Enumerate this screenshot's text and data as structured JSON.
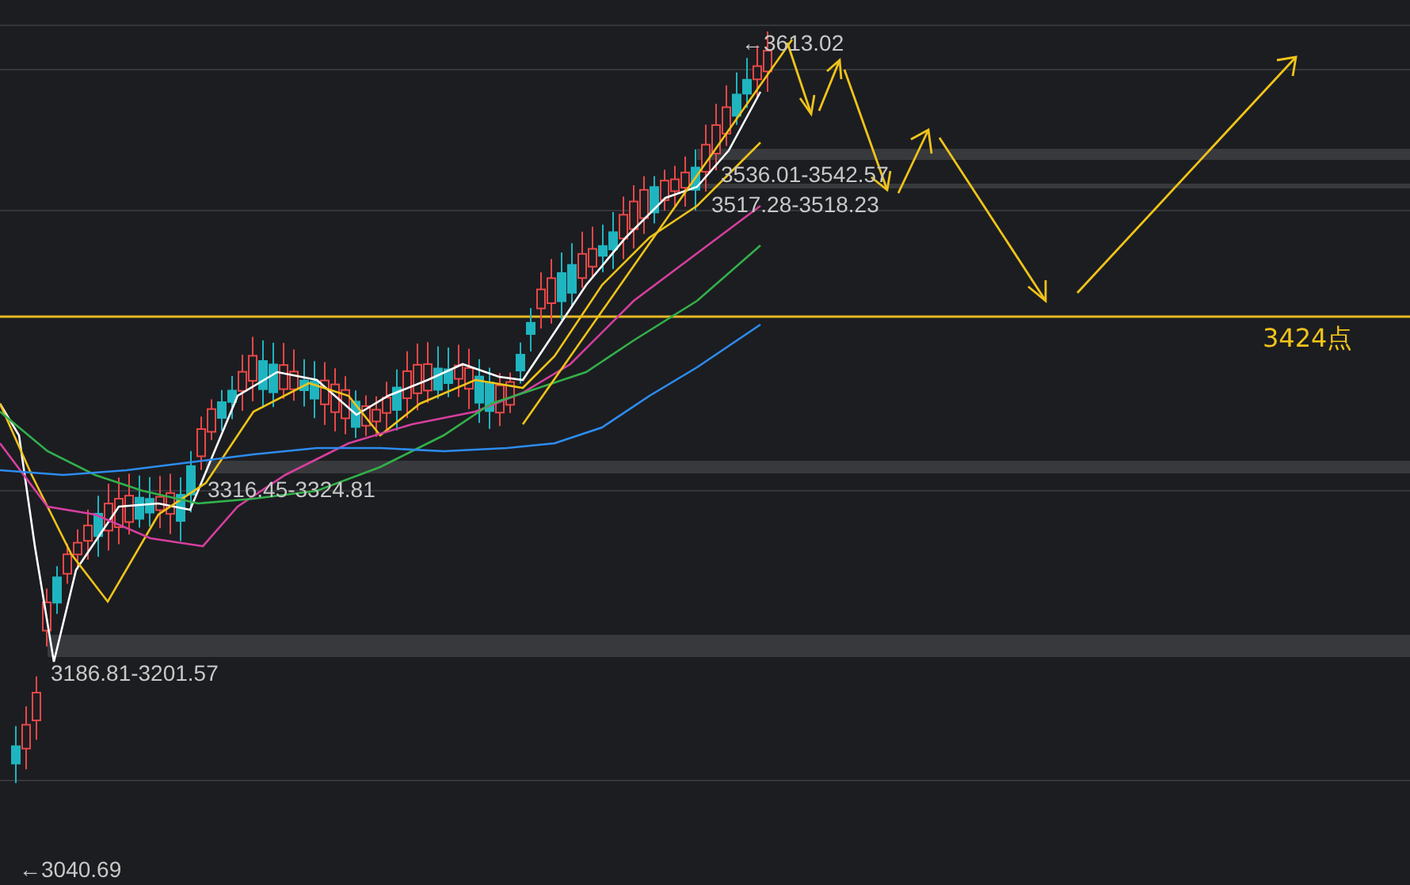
{
  "chart": {
    "price_labels": [
      {
        "text": "←3613.02"
      },
      {
        "text": "3536.01-3542.57"
      },
      {
        "text": "3517.28-3518.23"
      },
      {
        "text": "3316.45-3324.81"
      },
      {
        "text": "3186.81-3201.57"
      },
      {
        "text": "←3040.69"
      }
    ],
    "level_line": {
      "label": "3424点"
    }
  }
}
